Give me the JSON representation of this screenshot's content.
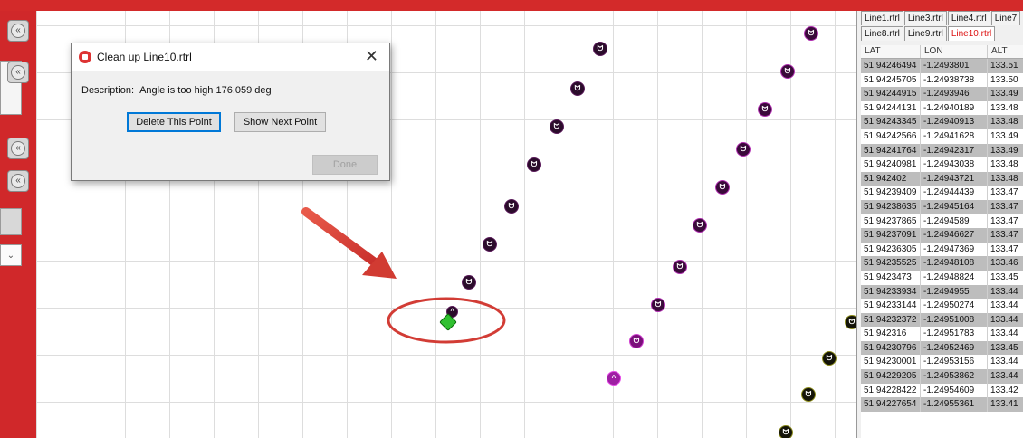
{
  "dialog": {
    "title": "Clean up Line10.rtrl",
    "description_label": "Description:",
    "description_value": "Angle is too high 176.059 deg",
    "delete_button": "Delete This Point",
    "next_button": "Show Next Point",
    "done_button": "Done",
    "close_glyph": "✕"
  },
  "tabs_row1": [
    "Line1.rtrl",
    "Line3.rtrl",
    "Line4.rtrl",
    "Line7"
  ],
  "tabs_row2": [
    "Line8.rtrl",
    "Line9.rtrl",
    "Line10.rtrl"
  ],
  "active_tab": "Line10.rtrl",
  "table": {
    "headers": [
      "LAT",
      "LON",
      "ALT"
    ],
    "rows": [
      [
        "51.94246494",
        "-1.2493801",
        "133.51"
      ],
      [
        "51.94245705",
        "-1.24938738",
        "133.50"
      ],
      [
        "51.94244915",
        "-1.2493946",
        "133.49"
      ],
      [
        "51.94244131",
        "-1.24940189",
        "133.48"
      ],
      [
        "51.94243345",
        "-1.24940913",
        "133.48"
      ],
      [
        "51.94242566",
        "-1.24941628",
        "133.49"
      ],
      [
        "51.94241764",
        "-1.24942317",
        "133.49"
      ],
      [
        "51.94240981",
        "-1.24943038",
        "133.48"
      ],
      [
        "51.942402",
        "-1.24943721",
        "133.48"
      ],
      [
        "51.94239409",
        "-1.24944439",
        "133.47"
      ],
      [
        "51.94238635",
        "-1.24945164",
        "133.47"
      ],
      [
        "51.94237865",
        "-1.2494589",
        "133.47"
      ],
      [
        "51.94237091",
        "-1.24946627",
        "133.47"
      ],
      [
        "51.94236305",
        "-1.24947369",
        "133.47"
      ],
      [
        "51.94235525",
        "-1.24948108",
        "133.46"
      ],
      [
        "51.9423473",
        "-1.24948824",
        "133.45"
      ],
      [
        "51.94233934",
        "-1.2494955",
        "133.44"
      ],
      [
        "51.94233144",
        "-1.24950274",
        "133.44"
      ],
      [
        "51.94232372",
        "-1.24951008",
        "133.44"
      ],
      [
        "51.942316",
        "-1.24951783",
        "133.44"
      ],
      [
        "51.94230796",
        "-1.24952469",
        "133.45"
      ],
      [
        "51.94230001",
        "-1.24953156",
        "133.44"
      ],
      [
        "51.94229205",
        "-1.24953862",
        "133.44"
      ],
      [
        "51.94228422",
        "-1.24954609",
        "133.42"
      ],
      [
        "51.94227654",
        "-1.24955361",
        "133.41"
      ]
    ]
  },
  "colors": {
    "accent_red": "#d32a2a",
    "point_dark": "#2b0c2b",
    "point_magenta": "#9e1fa3",
    "selected_green": "#30c030",
    "active_tab_text": "#dd1111"
  },
  "icons": {
    "point": "track-point-icon",
    "selected": "selected-point-icon",
    "side_buttons": [
      "collapse-icon",
      "collapse-icon",
      "collapse-icon",
      "collapse-icon"
    ]
  }
}
